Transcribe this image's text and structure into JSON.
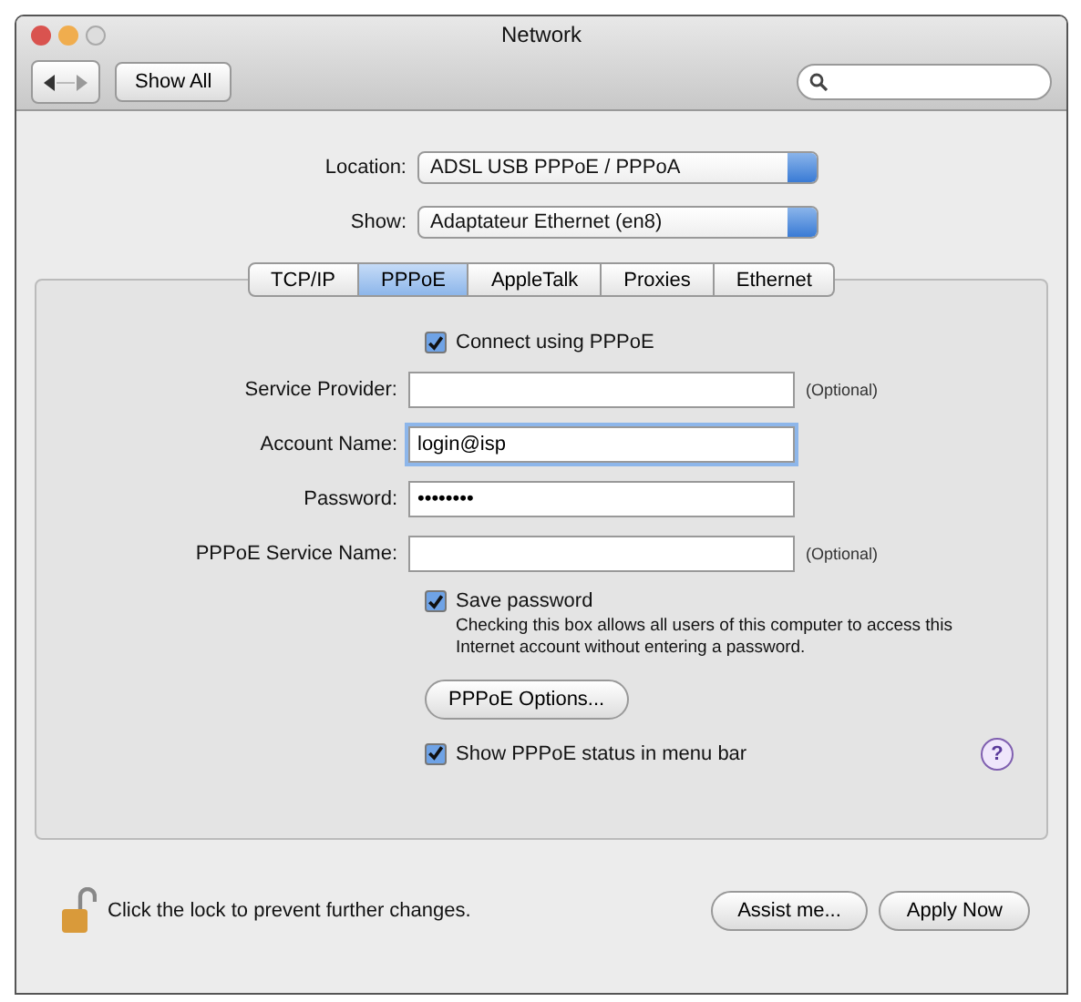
{
  "window": {
    "title": "Network"
  },
  "toolbar": {
    "show_all": "Show All"
  },
  "location": {
    "label": "Location:",
    "value": "ADSL USB PPPoE / PPPoA"
  },
  "show": {
    "label": "Show:",
    "value": "Adaptateur Ethernet (en8)"
  },
  "tabs": [
    {
      "label": "TCP/IP",
      "selected": false
    },
    {
      "label": "PPPoE",
      "selected": true
    },
    {
      "label": "AppleTalk",
      "selected": false
    },
    {
      "label": "Proxies",
      "selected": false
    },
    {
      "label": "Ethernet",
      "selected": false
    }
  ],
  "connect": {
    "label": "Connect using PPPoE",
    "checked": true
  },
  "fields": [
    {
      "label": "Service Provider:",
      "note": "(Optional)",
      "focused": false
    },
    {
      "label": "Account Name:",
      "value": "login@isp",
      "focused": true
    },
    {
      "label": "Password:",
      "value": "••••••••",
      "focused": false
    },
    {
      "label": "PPPoE Service Name:",
      "note": "(Optional)",
      "focused": false
    }
  ],
  "save_password": {
    "label": "Save password",
    "checked": true,
    "description": "Checking this box allows all users of this computer to access this Internet account without entering a password."
  },
  "options_button": "PPPoE Options...",
  "show_status": {
    "label": "Show PPPoE status in menu bar",
    "checked": true
  },
  "help": "?",
  "footer": {
    "lock_text": "Click the lock to prevent further changes.",
    "buttons": [
      "Assist me...",
      "Apply Now"
    ]
  }
}
